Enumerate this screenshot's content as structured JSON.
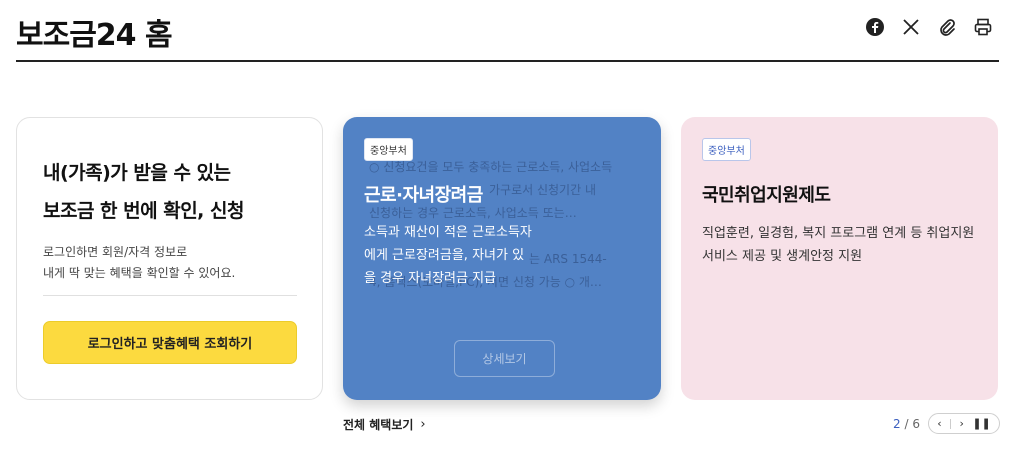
{
  "page": {
    "title": "보조금24 홈"
  },
  "share": {
    "icons": [
      "facebook-icon",
      "x-icon",
      "link-icon",
      "print-icon"
    ]
  },
  "login_card": {
    "heading_line1": "내(가족)가 받을 수 있는",
    "heading_line2": "보조금 한 번에 확인, 신청",
    "desc_line1": "로그인하면 회원/자격 정보로",
    "desc_line2": "내게 딱 맞는 혜택을 확인할 수 있어요.",
    "button_label": "로그인하고 맞춤혜택 조회하기"
  },
  "cards": [
    {
      "badge": "중앙부처",
      "title": "근로·자녀장려금",
      "desc": "소득과 재산이 적은 근로소득자에게 근로장려금을, 자녀가 있을 경우 자녀장려금 지급",
      "ghost_text_1": "○ 신청요건을 모두 충족하는 근로소득, 사업소득",
      "ghost_text_2": "가구로서 신청기간 내",
      "ghost_text_3": "신청하는 경우 근로소득, 사업소득 또는…",
      "ghost_text_4": "는 ARS 1544-",
      "ghost_text_5": "4, 홈택스(모바일,PC), 서면 신청 가능 ○ 개…",
      "ghost_button": "상세보기"
    },
    {
      "badge": "중앙부처",
      "title": "국민취업지원제도",
      "desc": "직업훈련, 일경험, 복지 프로그램 연계 등 취업지원서비스 제공 및 생계안정 지원"
    }
  ],
  "footer": {
    "view_all": "전체 혜택보기",
    "page_current": "2",
    "page_total": "/ 6"
  },
  "colors": {
    "accent_yellow": "#fcda3f",
    "card_blue": "#5282c5",
    "card_pink": "#f7e1e8",
    "pager_blue": "#3b5fbf"
  }
}
